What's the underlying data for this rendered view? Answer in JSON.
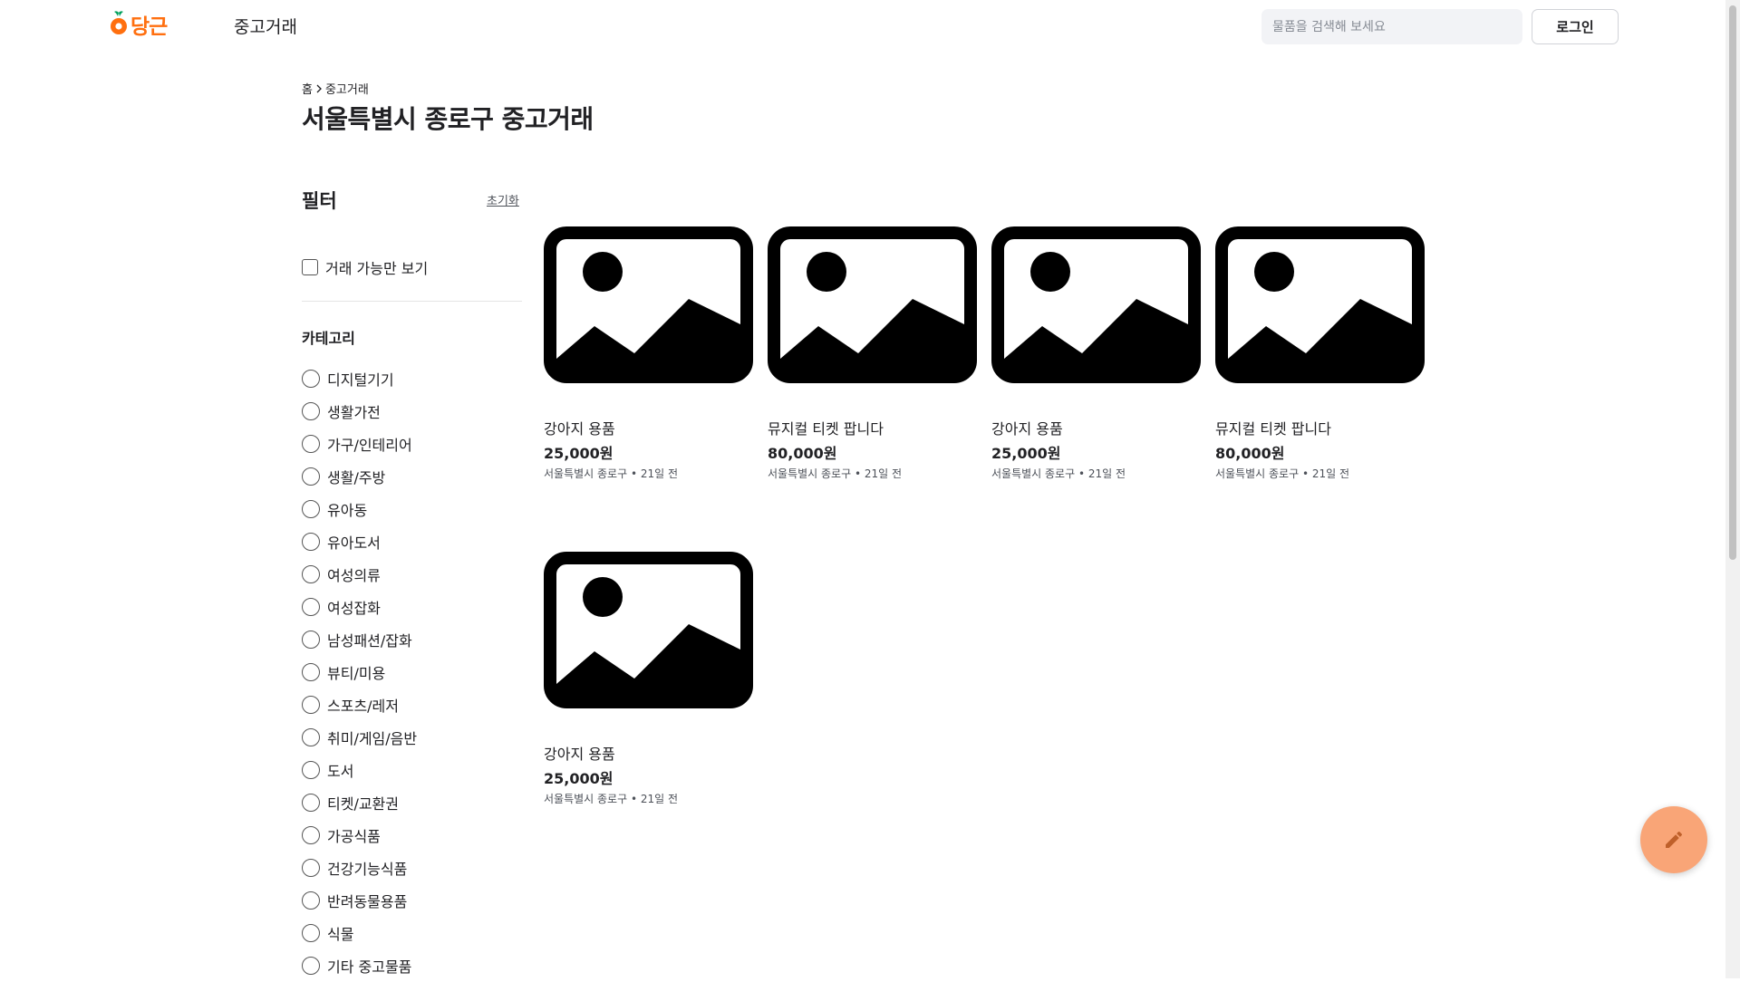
{
  "header": {
    "logo_text": "당근",
    "nav_label": "중고거래",
    "search_placeholder": "물품을 검색해 보세요",
    "login_label": "로그인"
  },
  "breadcrumb": {
    "home": "홈",
    "current": "중고거래"
  },
  "page_title": "서울특별시 종로구 중고거래",
  "filter": {
    "title": "필터",
    "reset_label": "초기화",
    "available_only_label": "거래 가능만 보기",
    "available_only_checked": false,
    "category_title": "카테고리",
    "categories": [
      "디지털기기",
      "생활가전",
      "가구/인테리어",
      "생활/주방",
      "유아동",
      "유아도서",
      "여성의류",
      "여성잡화",
      "남성패션/잡화",
      "뷰티/미용",
      "스포츠/레저",
      "취미/게임/음반",
      "도서",
      "티켓/교환권",
      "가공식품",
      "건강기능식품",
      "반려동물용품",
      "식물",
      "기타 중고물품"
    ]
  },
  "products": [
    {
      "title": "강아지 용품",
      "price": "25,000원",
      "location": "서울특별시 종로구",
      "time": "21일 전",
      "image_icon": "image-placeholder-icon"
    },
    {
      "title": "뮤지컬 티켓 팝니다",
      "price": "80,000원",
      "location": "서울특별시 종로구",
      "time": "21일 전",
      "image_icon": "image-placeholder-icon"
    },
    {
      "title": "강아지 용품",
      "price": "25,000원",
      "location": "서울특별시 종로구",
      "time": "21일 전",
      "image_icon": "image-placeholder-icon"
    },
    {
      "title": "뮤지컬 티켓 팝니다",
      "price": "80,000원",
      "location": "서울특별시 종로구",
      "time": "21일 전",
      "image_icon": "image-placeholder-icon"
    },
    {
      "title": "강아지 용품",
      "price": "25,000원",
      "location": "서울특별시 종로구",
      "time": "21일 전",
      "image_icon": "image-placeholder-icon"
    }
  ],
  "fab_icon": "pencil-icon",
  "colors": {
    "brand": "#ff6f0f",
    "fab": "#f9a577",
    "text": "#212124",
    "search_bg": "#f2f3f6"
  }
}
